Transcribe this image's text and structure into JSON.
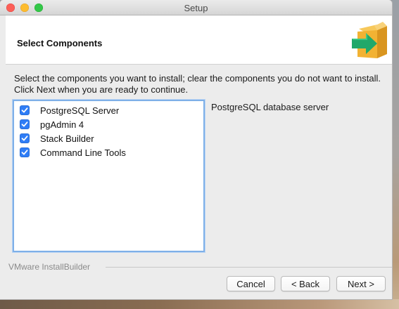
{
  "window": {
    "title": "Setup"
  },
  "header": {
    "title": "Select Components",
    "icon": "installer-box-arrow-icon"
  },
  "intro_text": "Select the components you want to install; clear the components you do not want to install. Click Next when you are ready to continue.",
  "components": [
    {
      "label": "PostgreSQL Server",
      "checked": true
    },
    {
      "label": "pgAdmin 4",
      "checked": true
    },
    {
      "label": "Stack Builder",
      "checked": true
    },
    {
      "label": "Command Line Tools",
      "checked": true
    }
  ],
  "description": "PostgreSQL database server",
  "footer": {
    "brand": "VMware InstallBuilder",
    "cancel_label": "Cancel",
    "back_label": "< Back",
    "next_label": "Next >"
  },
  "colors": {
    "checkbox_accent": "#2f7df6",
    "focus_ring": "#7fb0e8",
    "icon_green": "#21a86a",
    "icon_box": "#f2b233"
  }
}
